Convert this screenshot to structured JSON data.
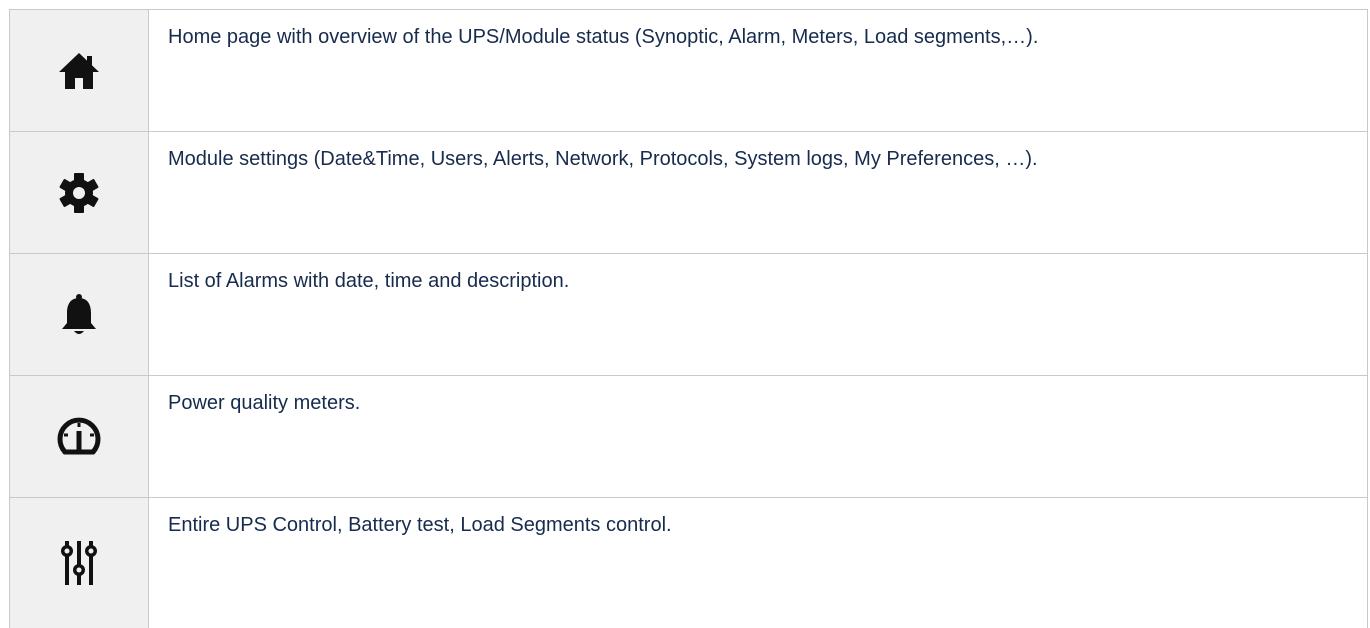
{
  "rows": [
    {
      "icon": "home-icon",
      "text": "Home page with overview of the UPS/Module status (Synoptic, Alarm, Meters, Load segments,…)."
    },
    {
      "icon": "gear-icon",
      "text": "Module settings (Date&Time, Users, Alerts, Network, Protocols, System logs, My Preferences, …)."
    },
    {
      "icon": "bell-icon",
      "text": "List of Alarms with date, time and description."
    },
    {
      "icon": "gauge-icon",
      "text": "Power quality meters."
    },
    {
      "icon": "sliders-icon",
      "text": "Entire UPS Control, Battery test, Load Segments control."
    }
  ],
  "colors": {
    "icon": "#111111",
    "text": "#172b4d",
    "icon_cell_bg": "#f0f0f0",
    "border": "#c9c9c9"
  }
}
